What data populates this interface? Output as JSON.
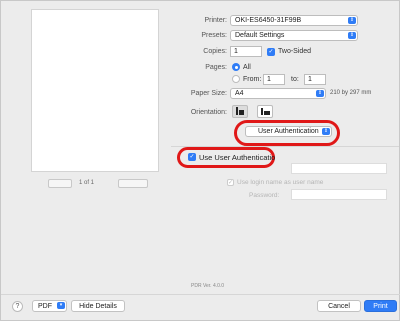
{
  "printer": {
    "label": "Printer:",
    "value": "OKI-ES6450-31F99B"
  },
  "presets": {
    "label": "Presets:",
    "value": "Default Settings"
  },
  "copies": {
    "label": "Copies:",
    "value": "1",
    "two_sided_label": "Two-Sided",
    "two_sided_checked": true
  },
  "pages": {
    "label": "Pages:",
    "all_label": "All",
    "from_label": "From:",
    "from_value": "1",
    "to_label": "to:",
    "to_value": "1"
  },
  "paper_size": {
    "label": "Paper Size:",
    "value": "A4",
    "dimensions": "210 by 297 mm"
  },
  "orientation": {
    "label": "Orientation:",
    "portrait_icon": "portrait-icon",
    "landscape_icon": "landscape-icon"
  },
  "section_menu": {
    "value": "User Authentication"
  },
  "user_auth": {
    "use_label": "Use User Authenticatio",
    "use_checked": true,
    "login_label": "Use login name as user name",
    "password_label": "Password:"
  },
  "preview": {
    "page_indicator": "1 of 1"
  },
  "version": "PDR Ver. 4.0.0",
  "footer": {
    "help_label": "?",
    "pdf_label": "PDF",
    "hide_details_label": "Hide Details",
    "cancel_label": "Cancel",
    "print_label": "Print"
  },
  "colors": {
    "accent": "#2f7cf6",
    "highlight_ring": "#e01818"
  }
}
